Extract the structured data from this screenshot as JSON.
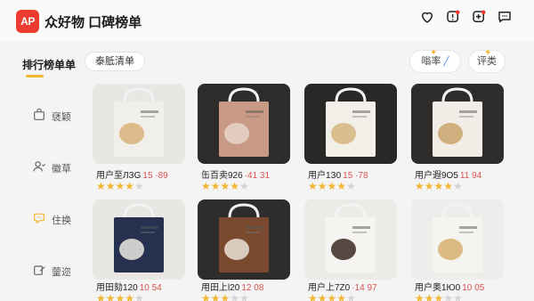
{
  "app": {
    "logo_text": "AP",
    "title": "众好物 口碑榜单"
  },
  "tabs": {
    "active_label": "排行榜单单",
    "secondary_label": "泰胝清单"
  },
  "actions": {
    "left_label": "嗡率",
    "right_label": "评类"
  },
  "sidebar": {
    "items": [
      {
        "label": "褎颖",
        "icon": "bag-icon"
      },
      {
        "label": "徽草",
        "icon": "user-icon"
      },
      {
        "label": "住换",
        "icon": "chat-icon"
      },
      {
        "label": "蓥迩",
        "icon": "edit-icon"
      }
    ]
  },
  "products": [
    {
      "name": "用户至ЛЗG",
      "price": "15 ·89",
      "rating": 4,
      "bg": "#e9e7e4",
      "bag": "#f1efe9",
      "art": "#d8b27a"
    },
    {
      "name": "缶百卖926",
      "price": "·41 31",
      "rating": 4,
      "bg": "#2e2c2b",
      "bag": "#c89a86",
      "art": "#e7d4c7"
    },
    {
      "name": "用户1З0",
      "price": "15 ·78",
      "rating": 4,
      "bg": "#2a2826",
      "bag": "#f2efe8",
      "art": "#d7b57e"
    },
    {
      "name": "用户遐9O5",
      "price": "11 94",
      "rating": 4,
      "bg": "#2f2d2b",
      "bag": "#f1ede6",
      "art": "#c9a36b"
    },
    {
      "name": "用田劾120",
      "price": "10 54",
      "rating": 4,
      "bg": "#e9e7e4",
      "bag": "#25314f",
      "art": "#ece8e0"
    },
    {
      "name": "用田上l20",
      "price": "12 08",
      "rating": 3,
      "bg": "#2f2d2b",
      "bag": "#7a4a2f",
      "art": "#ece2d6"
    },
    {
      "name": "用户上7Z0",
      "price": "·14 97",
      "rating": 4,
      "bg": "#ecebe8",
      "bag": "#f5f4f1",
      "art": "#3b2a22"
    },
    {
      "name": "用户奥1Ю0",
      "price": "10 05",
      "rating": 3,
      "bg": "#eeedeb",
      "bag": "#f6f4ef",
      "art": "#d7b06f"
    }
  ],
  "colors": {
    "brand": "#ee3b2f",
    "accent": "#f2b630",
    "price": "#d9534f"
  },
  "top_icons": [
    "heart-icon",
    "notification-icon",
    "add-icon",
    "message-icon"
  ]
}
